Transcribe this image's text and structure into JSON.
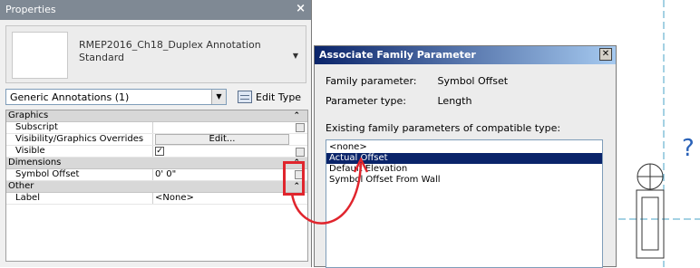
{
  "properties_panel": {
    "title": "Properties",
    "close_glyph": "×",
    "type_selector": {
      "family_name": "RMEP2016_Ch18_Duplex Annotation Standard",
      "dropdown_glyph": "▼"
    },
    "category_selector": "Generic Annotations (1)",
    "edit_type_label": "Edit Type",
    "groups": {
      "graphics": {
        "name": "Graphics",
        "subscript_label": "Subscript",
        "subscript_value": "",
        "vg_label": "Visibility/Graphics Overrides",
        "vg_button": "Edit...",
        "visible_label": "Visible",
        "visible_check": "✓"
      },
      "dimensions": {
        "name": "Dimensions",
        "symbol_offset_label": "Symbol Offset",
        "symbol_offset_value": "0'  0\""
      },
      "other": {
        "name": "Other",
        "label_label": "Label",
        "label_value": "<None>"
      }
    },
    "collapse_glyph": "⌃"
  },
  "dialog": {
    "title": "Associate Family Parameter",
    "close_glyph": "✕",
    "family_parameter_label": "Family parameter:",
    "family_parameter_value": "Symbol Offset",
    "parameter_type_label": "Parameter type:",
    "parameter_type_value": "Length",
    "list_label": "Existing family parameters of compatible type:",
    "items": [
      "<none>",
      "Actual Offset",
      "Default Elevation",
      "Symbol Offset From Wall"
    ],
    "selected_index": 1
  },
  "drawing": {
    "question_mark": "?"
  },
  "colors": {
    "callout_red": "#e0252d",
    "dialog_title_start": "#0a246a",
    "selection": "#0a246a",
    "dashed_line": "#4aa3c7"
  }
}
